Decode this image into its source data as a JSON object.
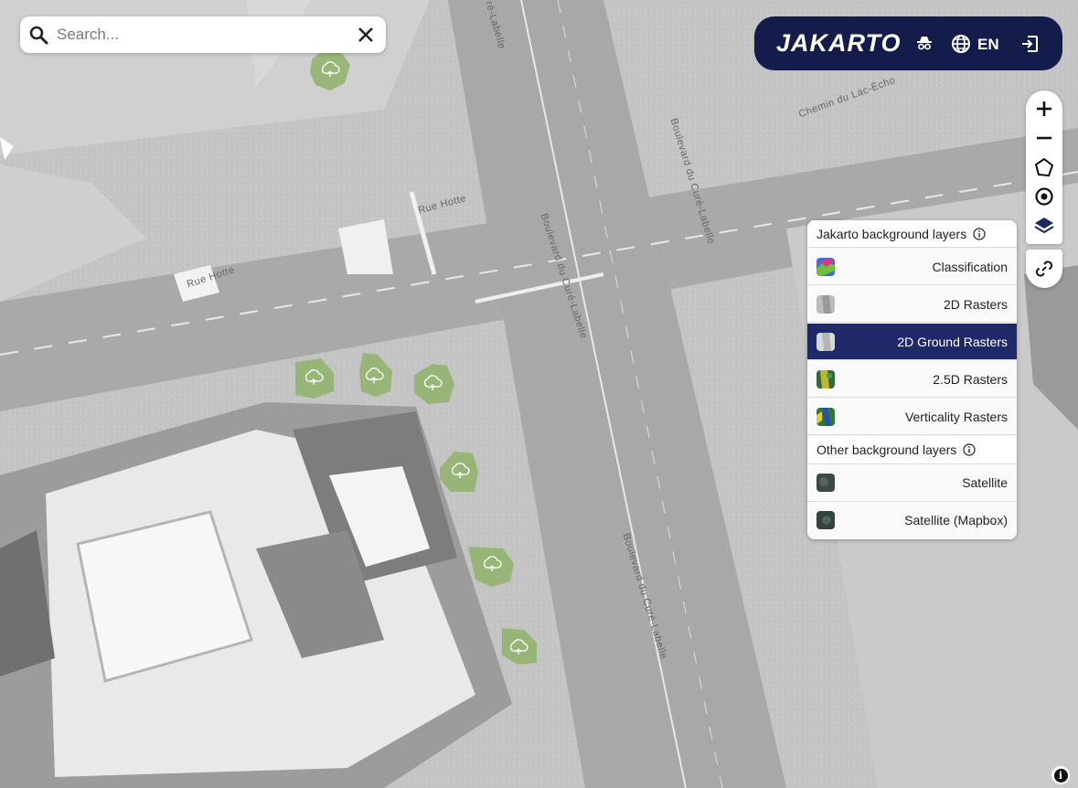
{
  "search": {
    "placeholder": "Search..."
  },
  "header": {
    "logo": "JAKARTO",
    "language": "EN"
  },
  "map": {
    "streets": [
      "Chemin du Lac-Écho",
      "Boulevard du Curé-Labelle",
      "Boulevard du Curé-Labelle",
      "Boulevard du Curé-Labelle",
      "Rue Hotte",
      "Rue Hotte",
      "ré-Labelle"
    ]
  },
  "layers_panel": {
    "jakarto_title": "Jakarto background layers",
    "jakarto_layers": [
      {
        "label": "Classification",
        "active": false
      },
      {
        "label": "2D Rasters",
        "active": false
      },
      {
        "label": "2D Ground Rasters",
        "active": true
      },
      {
        "label": "2.5D Rasters",
        "active": false
      },
      {
        "label": "Verticality Rasters",
        "active": false
      }
    ],
    "other_title": "Other background layers",
    "other_layers": [
      {
        "label": "Satellite",
        "active": false
      },
      {
        "label": "Satellite (Mapbox)",
        "active": false
      }
    ]
  },
  "colors": {
    "brand_navy": "#141c4b",
    "active_row": "#1f2868",
    "marker_green": "#8fb36a"
  }
}
